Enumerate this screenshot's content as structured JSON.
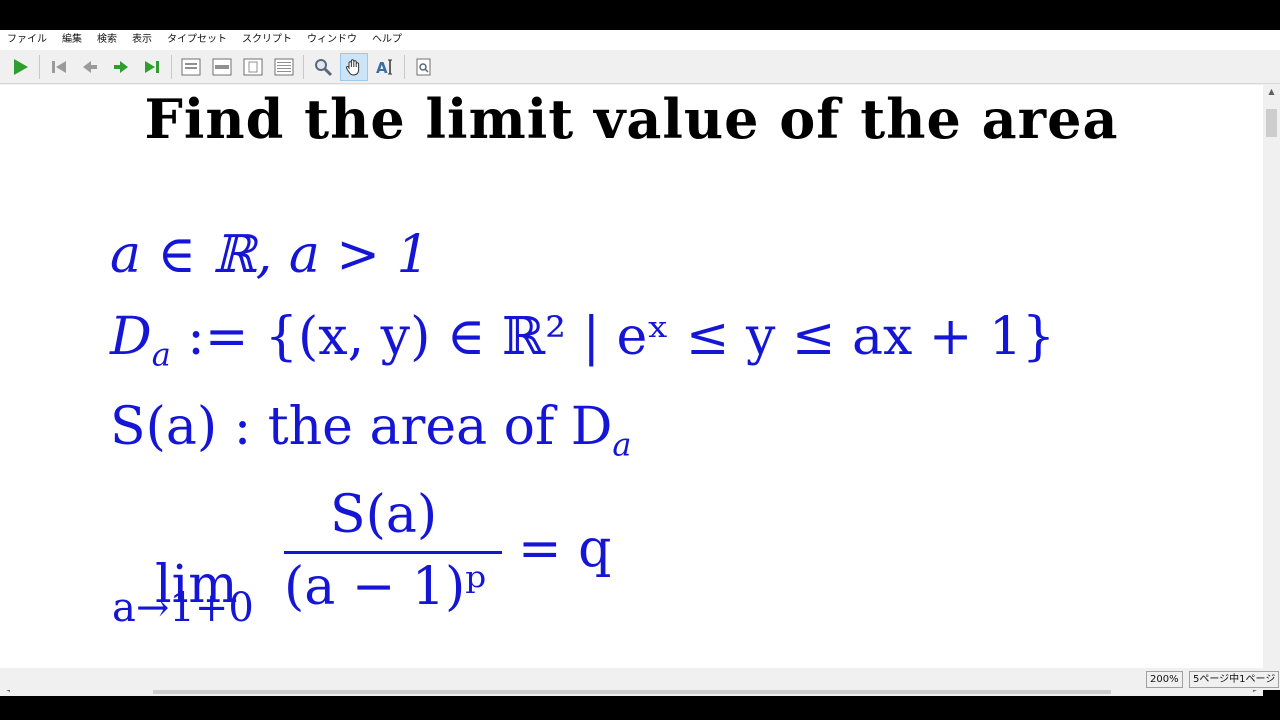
{
  "menu": [
    "ファイル",
    "編集",
    "検索",
    "表示",
    "タイプセット",
    "スクリプト",
    "ウィンドウ",
    "ヘルプ"
  ],
  "toolbar": {
    "icons": [
      "typeset-run-icon",
      "first-page-icon",
      "prev-page-icon",
      "next-page-icon",
      "last-page-icon",
      "single-page-icon",
      "page-width-icon",
      "fit-page-icon",
      "double-page-icon",
      "magnify-icon",
      "hand-scroll-icon",
      "text-select-icon",
      "find-in-page-icon"
    ]
  },
  "document": {
    "title": "Find the limit value of the area",
    "line1": "a ∈ ℝ, a > 1",
    "line2_lhs": "D",
    "line2_sub": "a",
    "line2_rhs": " := {(x, y) ∈ ℝ² | eˣ ≤ y ≤ ax + 1}",
    "line3_a": "S(a) : the area of D",
    "line3_sub": "a",
    "limit_word": "lim",
    "limit_sub": "a→1+0",
    "frac_num": "S(a)",
    "frac_den": "(a − 1)ᵖ",
    "limit_rhs": "= q"
  },
  "status": {
    "zoom": "200%",
    "page": "5ページ中1ページ"
  },
  "colors": {
    "math": "#1515d6",
    "title": "#000000",
    "run_icon": "#2e9e2e"
  }
}
